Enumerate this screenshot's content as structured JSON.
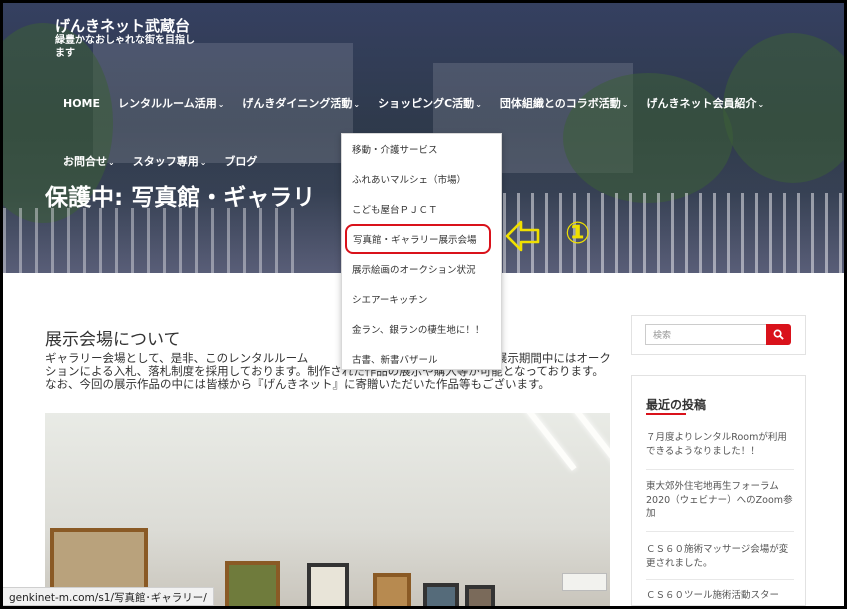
{
  "site": {
    "title": "げんきネット武蔵台",
    "description": "緑豊かなおしゃれな街を目指します"
  },
  "nav": {
    "row1": [
      {
        "label": "HOME",
        "chevron": ""
      },
      {
        "label": "レンタルルーム活用",
        "chevron": "⌄"
      },
      {
        "label": "げんきダイニング活動",
        "chevron": "⌄"
      },
      {
        "label": "ショッピングC活動",
        "chevron": "⌄"
      },
      {
        "label": "団体組織とのコラボ活動",
        "chevron": "⌄"
      },
      {
        "label": "げんきネット会員紹介",
        "chevron": "⌄"
      }
    ],
    "row2": [
      {
        "label": "お問合せ",
        "chevron": "⌄"
      },
      {
        "label": "スタッフ専用",
        "chevron": "⌄"
      },
      {
        "label": "ブログ",
        "chevron": ""
      }
    ]
  },
  "page_heading": "保護中: 写真館・ギャラリ",
  "dropdown": {
    "items": [
      "移動・介護サービス",
      "ふれあいマルシェ（市場）",
      "こども屋台ＰＪＣＴ",
      "写真館・ギャラリー展示会場",
      "展示絵画のオークション状況",
      "シエアーキッチン",
      "金ラン、銀ランの棲生地に！！",
      "古書、新書バザール"
    ],
    "highlighted_index": 3
  },
  "annotation": {
    "number": "①",
    "color": "#f0e000"
  },
  "content": {
    "title": "展示会場について",
    "text": "ギャラリー会場として、是非、このレンタルルーム　　　　　　　　　　また、作品の 展示期間中にはオークションによる入札、落札制度を採用しております。制作された作品の展示や購入等が可能となっております。なお、今回の展示作品の中には皆様から『げんきネット』に寄贈いただいた作品等もございます。"
  },
  "sidebar": {
    "search_placeholder": "検索",
    "recent_title": "最近の投稿",
    "recent_posts": [
      "７月度よりレンタルRoomが利用できるようなりました！！",
      "東大郊外住宅地再生フォーラム2020（ウェビナー）へのZoom参加",
      "ＣＳ６０施術マッサージ会場が変更されました。",
      "ＣＳ６０ツール施術活動スター"
    ]
  },
  "status_bar": {
    "url": "genkinet-m.com/s1/写真館･ギャラリー/"
  },
  "colors": {
    "accent": "#d9121b",
    "hero_overlay": "#141c46"
  }
}
